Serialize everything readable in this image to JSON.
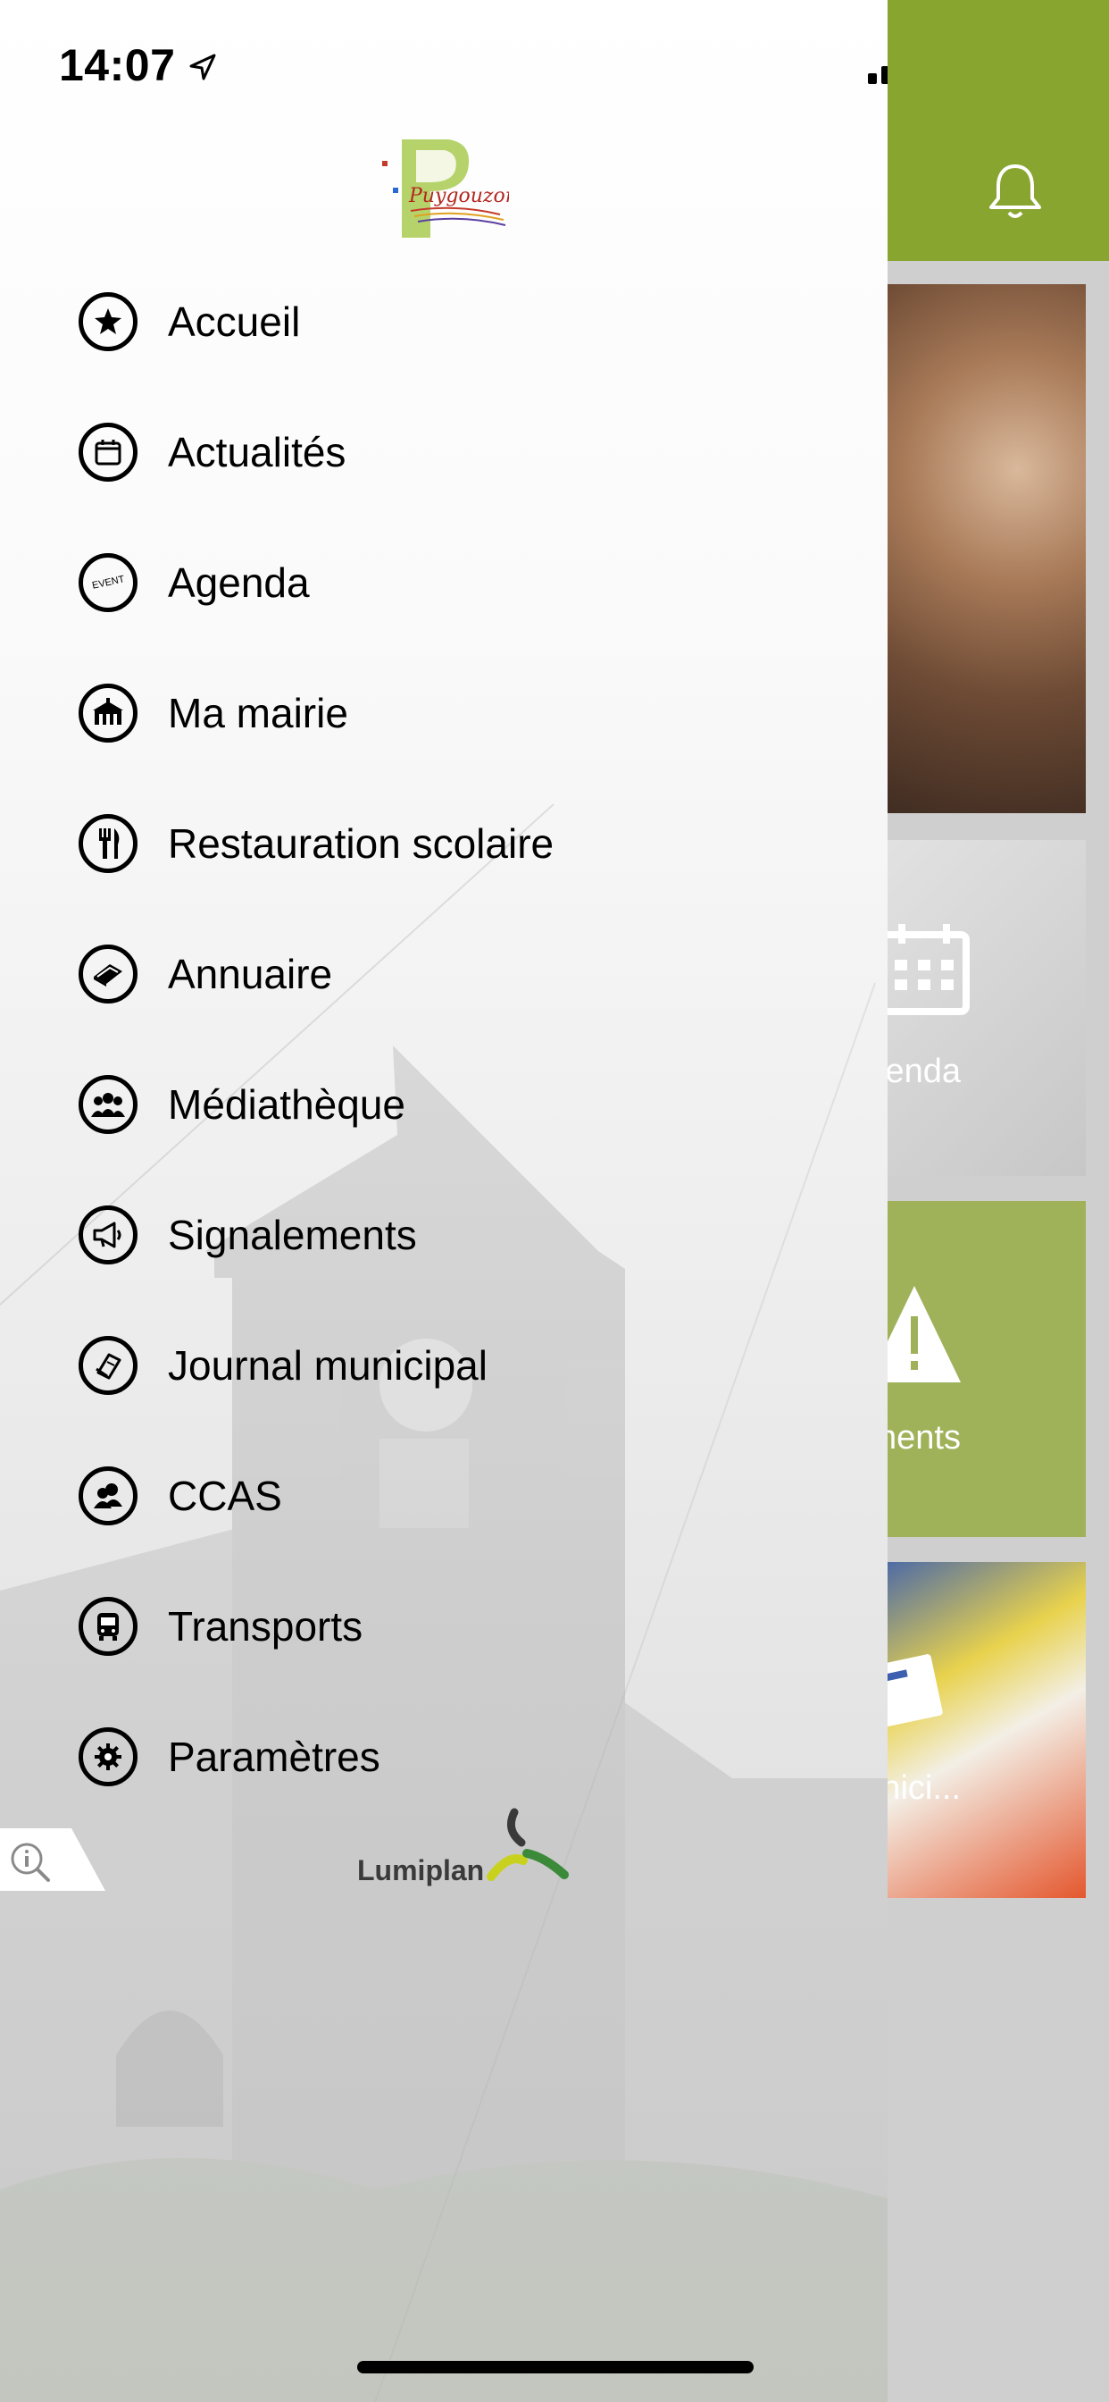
{
  "status_bar": {
    "time": "14:07"
  },
  "colors": {
    "brand_green": "#88a52f",
    "tile_green": "#9fb25a"
  },
  "background_app": {
    "tiles": [
      {
        "label": ""
      },
      {
        "label": "genda"
      },
      {
        "label": "alements"
      },
      {
        "label": "l munici..."
      }
    ]
  },
  "drawer": {
    "logo_text": "Puygouzon",
    "items": [
      {
        "label": "Accueil",
        "icon": "star-icon"
      },
      {
        "label": "Actualités",
        "icon": "calendar-icon"
      },
      {
        "label": "Agenda",
        "icon": "event-icon"
      },
      {
        "label": "Ma mairie",
        "icon": "town-hall-icon"
      },
      {
        "label": "Restauration scolaire",
        "icon": "fork-knife-icon"
      },
      {
        "label": "Annuaire",
        "icon": "book-icon"
      },
      {
        "label": "Médiathèque",
        "icon": "people-icon"
      },
      {
        "label": "Signalements",
        "icon": "megaphone-icon"
      },
      {
        "label": "Journal municipal",
        "icon": "newspaper-icon"
      },
      {
        "label": "CCAS",
        "icon": "users-icon"
      },
      {
        "label": "Transports",
        "icon": "bus-icon"
      },
      {
        "label": "Paramètres",
        "icon": "gear-icon"
      }
    ],
    "event_icon_text": "EVENT",
    "footer_brand": "Lumiplan"
  }
}
